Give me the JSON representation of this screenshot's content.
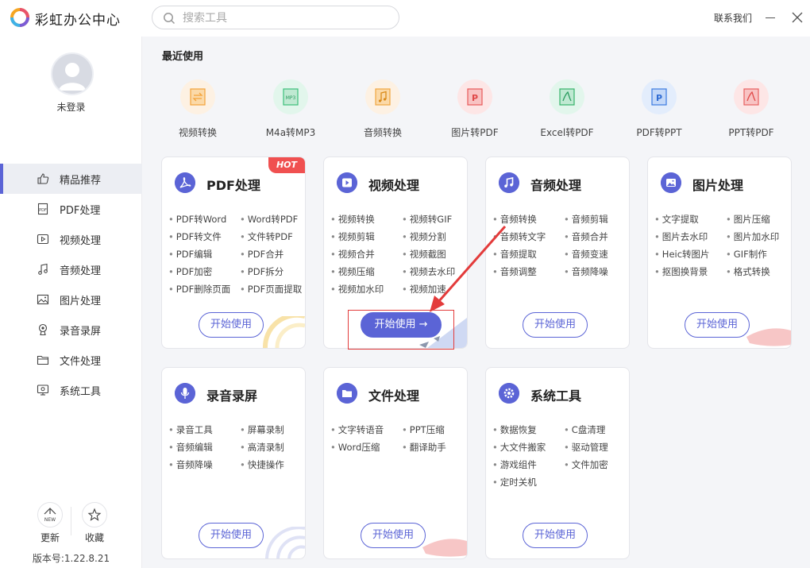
{
  "app": {
    "title": "彩虹办公中心"
  },
  "search": {
    "placeholder": "搜索工具"
  },
  "header": {
    "contact_label": "联系我们"
  },
  "user": {
    "status": "未登录"
  },
  "sidebar": {
    "items": [
      {
        "label": "精品推荐",
        "icon": "thumbs-up-icon",
        "active": true
      },
      {
        "label": "PDF处理",
        "icon": "pdf-file-icon",
        "active": false
      },
      {
        "label": "视频处理",
        "icon": "video-play-icon",
        "active": false
      },
      {
        "label": "音频处理",
        "icon": "music-note-icon",
        "active": false
      },
      {
        "label": "图片处理",
        "icon": "image-icon",
        "active": false
      },
      {
        "label": "录音录屏",
        "icon": "microphone-icon",
        "active": false
      },
      {
        "label": "文件处理",
        "icon": "folder-icon",
        "active": false
      },
      {
        "label": "系统工具",
        "icon": "monitor-icon",
        "active": false
      }
    ],
    "update_label": "更新",
    "favorite_label": "收藏",
    "version": "版本号:1.22.8.21"
  },
  "recent": {
    "title": "最近使用",
    "items": [
      {
        "label": "视频转换",
        "color": "#f3a33a"
      },
      {
        "label": "M4a转MP3",
        "color": "#3cbf7a"
      },
      {
        "label": "音频转换",
        "color": "#f0a640"
      },
      {
        "label": "图片转PDF",
        "color": "#e85a5a"
      },
      {
        "label": "Excel转PDF",
        "color": "#36b36b"
      },
      {
        "label": "PDF转PPT",
        "color": "#3c7be0"
      },
      {
        "label": "PPT转PDF",
        "color": "#e86060"
      }
    ]
  },
  "cards": [
    {
      "title": "PDF处理",
      "icon": "pdf-acrobat-icon",
      "hot": "HOT",
      "tools": [
        "PDF转Word",
        "Word转PDF",
        "PDF转文件",
        "文件转PDF",
        "PDF编辑",
        "PDF合并",
        "PDF加密",
        "PDF拆分",
        "PDF删除页面",
        "PDF页面提取"
      ],
      "button": "开始使用"
    },
    {
      "title": "视频处理",
      "icon": "video-play-icon",
      "tools": [
        "视频转换",
        "视频转GIF",
        "视频剪辑",
        "视频分割",
        "视频合并",
        "视频截图",
        "视频压缩",
        "视频去水印",
        "视频加水印",
        "视频加速"
      ],
      "button": "开始使用 →"
    },
    {
      "title": "音频处理",
      "icon": "music-note-icon",
      "tools": [
        "音频转换",
        "音频剪辑",
        "音频转文字",
        "音频合并",
        "音频提取",
        "音频变速",
        "音频调整",
        "音频降噪"
      ],
      "button": "开始使用"
    },
    {
      "title": "图片处理",
      "icon": "image-icon",
      "tools": [
        "文字提取",
        "图片压缩",
        "图片去水印",
        "图片加水印",
        "Heic转图片",
        "GIF制作",
        "抠图换背景",
        "格式转换"
      ],
      "button": "开始使用"
    },
    {
      "title": "录音录屏",
      "icon": "microphone-icon",
      "tools": [
        "录音工具",
        "屏幕录制",
        "音频编辑",
        "高清录制",
        "音频降噪",
        "快捷操作"
      ],
      "button": "开始使用"
    },
    {
      "title": "文件处理",
      "icon": "folder-icon",
      "tools": [
        "文字转语音",
        "PPT压缩",
        "Word压缩",
        "翻译助手"
      ],
      "button": "开始使用"
    },
    {
      "title": "系统工具",
      "icon": "gear-icon",
      "tools": [
        "数据恢复",
        "C盘清理",
        "大文件搬家",
        "驱动管理",
        "游戏组件",
        "文件加密",
        "定时关机"
      ],
      "button": "开始使用"
    }
  ]
}
